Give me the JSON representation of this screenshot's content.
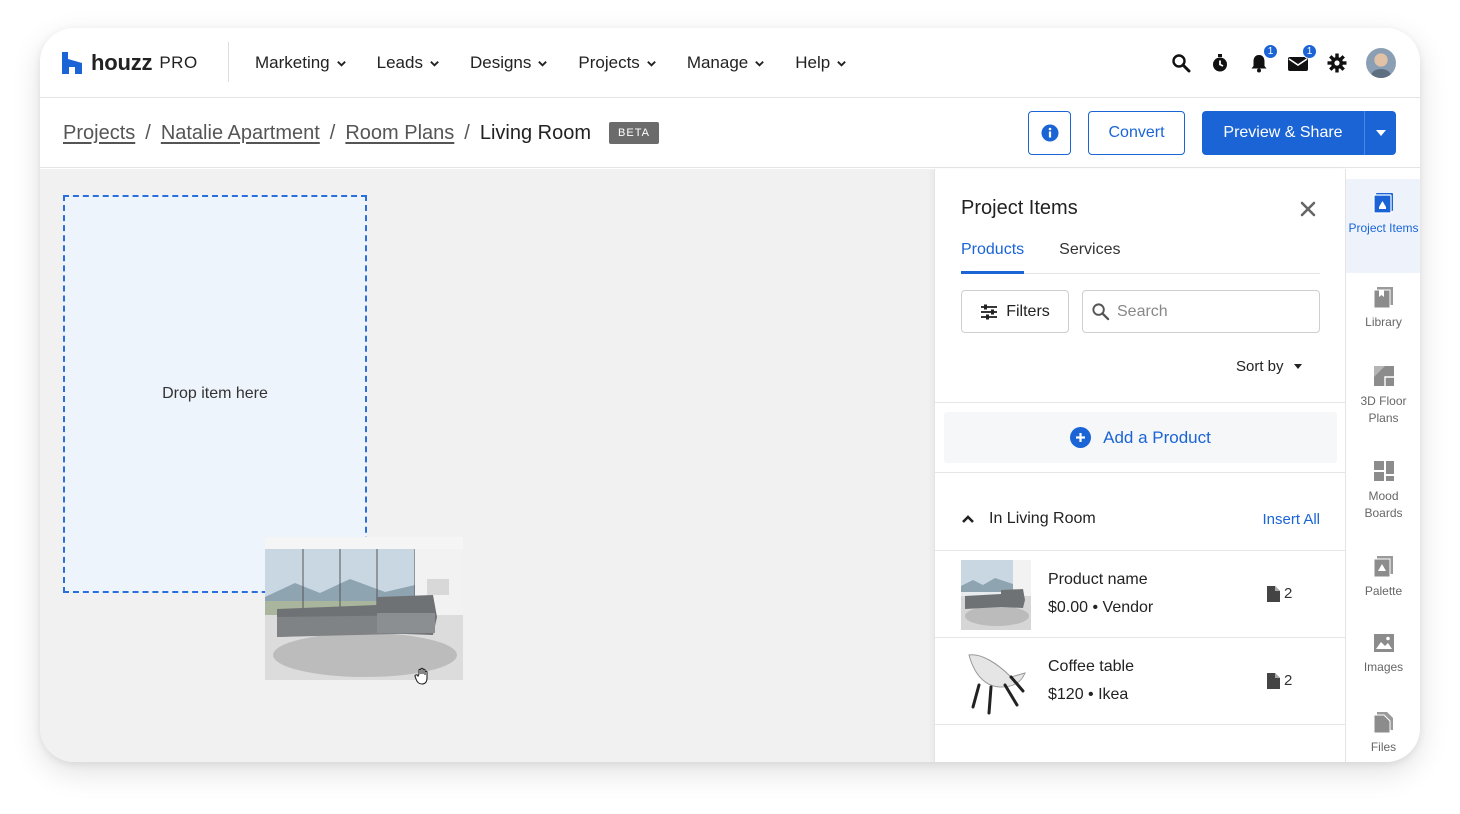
{
  "brand": {
    "name": "houzz",
    "suffix": "PRO",
    "color": "#1a64d6"
  },
  "nav": {
    "items": [
      {
        "label": "Marketing"
      },
      {
        "label": "Leads"
      },
      {
        "label": "Designs"
      },
      {
        "label": "Projects"
      },
      {
        "label": "Manage"
      },
      {
        "label": "Help"
      }
    ],
    "icons": [
      "search-icon",
      "timer-icon",
      "bell-icon",
      "inbox-icon",
      "gear-icon",
      "avatar"
    ],
    "notifications_count": "1",
    "messages_count": "1"
  },
  "breadcrumb": {
    "items": [
      "Projects",
      "Natalie Apartment",
      "Room Plans"
    ],
    "current": "Living Room",
    "badge": "BETA"
  },
  "actions": {
    "convert": "Convert",
    "preview_share": "Preview & Share"
  },
  "canvas": {
    "drop_text": "Drop item here"
  },
  "panel": {
    "title": "Project Items",
    "tabs": [
      "Products",
      "Services"
    ],
    "active_tab": "Products",
    "filters_label": "Filters",
    "search_placeholder": "Search",
    "sort_label": "Sort by",
    "add_product": "Add a Product",
    "section_title": "In Living Room",
    "insert_all": "Insert All",
    "items": [
      {
        "name": "Product name",
        "price": "$0.00 • Vendor",
        "files": "2"
      },
      {
        "name": "Coffee table",
        "price": "$120 • Ikea",
        "files": "2"
      }
    ]
  },
  "rail": {
    "items": [
      {
        "label": "Project Items",
        "icon": "project-items-icon",
        "active": true
      },
      {
        "label": "Library",
        "icon": "library-icon"
      },
      {
        "label": "3D Floor Plans",
        "icon": "floor-plans-icon"
      },
      {
        "label": "Mood Boards",
        "icon": "mood-boards-icon"
      },
      {
        "label": "Palette",
        "icon": "palette-icon"
      },
      {
        "label": "Images",
        "icon": "images-icon"
      },
      {
        "label": "Files",
        "icon": "files-icon"
      }
    ]
  }
}
